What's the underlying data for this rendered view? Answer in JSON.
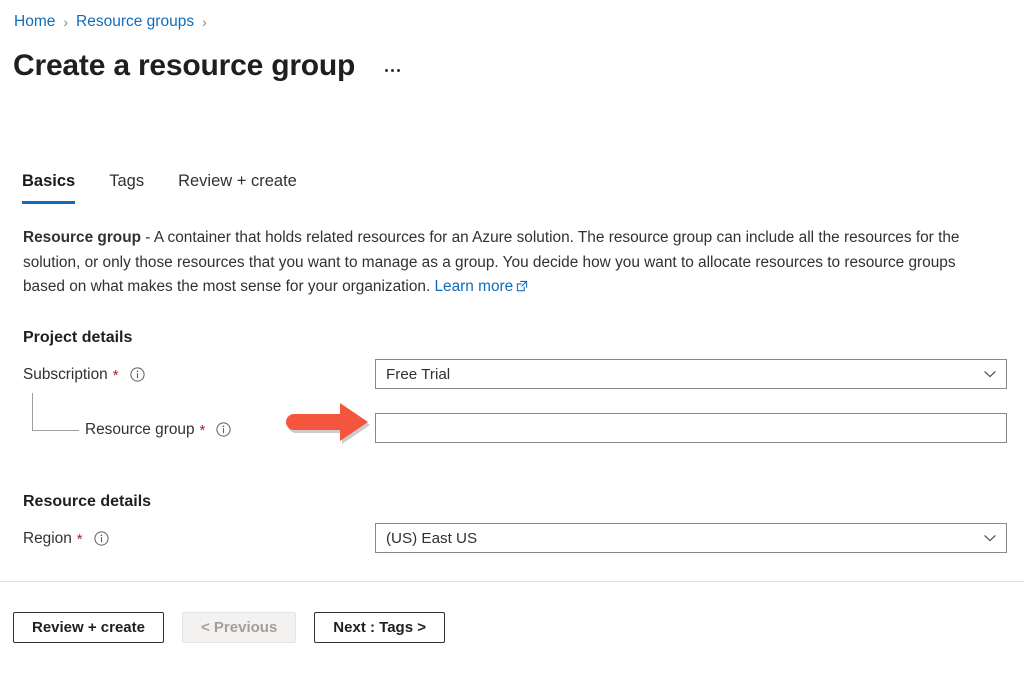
{
  "breadcrumb": {
    "items": [
      {
        "label": "Home",
        "separator": "›"
      },
      {
        "label": "Resource groups",
        "separator": "›"
      }
    ]
  },
  "header": {
    "title": "Create a resource group",
    "more_menu_icon": "ellipsis-icon"
  },
  "tabs": [
    {
      "label": "Basics",
      "active": true
    },
    {
      "label": "Tags",
      "active": false
    },
    {
      "label": "Review + create",
      "active": false
    }
  ],
  "description": {
    "bold_lead": "Resource group",
    "body": " - A container that holds related resources for an Azure solution. The resource group can include all the resources for the solution, or only those resources that you want to manage as a group. You decide how you want to allocate resources to resource groups based on what makes the most sense for your organization. ",
    "link_label": "Learn more",
    "link_icon": "external-link-icon"
  },
  "sections": {
    "project_details": {
      "heading": "Project details",
      "fields": [
        {
          "label": "Subscription",
          "required_marker": "*",
          "info_icon": "info-icon",
          "control": "dropdown",
          "value": "Free Trial",
          "placeholder": ""
        },
        {
          "label": "Resource group",
          "required_marker": "*",
          "info_icon": "info-icon",
          "control": "textbox",
          "value": "",
          "placeholder": ""
        }
      ]
    },
    "resource_details": {
      "heading": "Resource details",
      "fields": [
        {
          "label": "Region",
          "required_marker": "*",
          "info_icon": "info-icon",
          "control": "dropdown",
          "value": "(US) East US",
          "placeholder": ""
        }
      ]
    }
  },
  "footer": {
    "buttons": [
      {
        "label": "Review + create",
        "disabled": false
      },
      {
        "label": "< Previous",
        "disabled": true
      },
      {
        "label": "Next : Tags >",
        "disabled": false
      }
    ]
  },
  "annotation": {
    "arrow": {
      "icon": "right-arrow-annotation",
      "color": "#F4553F",
      "points_to": "Resource group"
    }
  },
  "colors": {
    "link": "#0f6cbd",
    "accent": "#0f6cbd",
    "required": "#a4262c",
    "text": "#323130",
    "border": "#8a8886",
    "annotation": "#F4553F"
  }
}
